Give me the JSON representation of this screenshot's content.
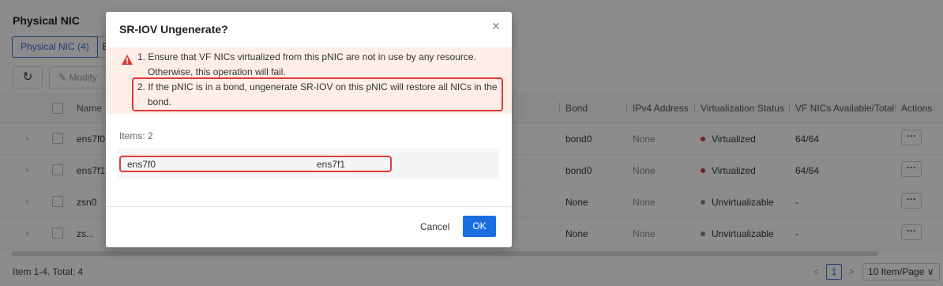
{
  "page": {
    "title": "Physical NIC",
    "tabs": [
      "Physical NIC (4)",
      "E"
    ],
    "toolbar": {
      "refresh_icon": "refresh-icon",
      "modify_label": "Modify"
    },
    "table": {
      "columns": {
        "name": "Name",
        "bond": "Bond",
        "ipv4": "IPv4 Address",
        "virt": "Virtualization Status",
        "vf": "VF NICs Available/Total",
        "actions": "Actions"
      },
      "rows": [
        {
          "name": "ens7f0",
          "bond": "bond0",
          "ipv4": "None",
          "status": "Virtualized",
          "status_color": "#d9363e",
          "vf": "64/64"
        },
        {
          "name": "ens7f1",
          "bond": "bond0",
          "ipv4": "None",
          "status": "Virtualized",
          "status_color": "#d9363e",
          "vf": "64/64"
        },
        {
          "name": "zsn0",
          "bond": "None",
          "ipv4": "None",
          "status": "Unvirtualizable",
          "status_color": "#888888",
          "vf": "-"
        },
        {
          "name": "zs...",
          "bond": "None",
          "ipv4": "None",
          "status": "Unvirtualizable",
          "status_color": "#888888",
          "vf": "-"
        }
      ],
      "actions_label": "···"
    },
    "footer": {
      "total": "Item 1-4. Total: 4",
      "current_page": "1",
      "page_size": "10 Item/Page"
    }
  },
  "dialog": {
    "title": "SR-IOV Ungenerate?",
    "close_icon": "close-icon",
    "warning_lines": [
      "1. Ensure that VF NICs virtualized from this pNIC are not in use by any resource.",
      "Otherwise, this operation will fail.",
      "2. If the pNIC is in a bond, ungenerate SR-IOV on this pNIC will restore all NICs in the",
      "bond."
    ],
    "items_label": "Items: 2",
    "items": [
      "ens7f0",
      "ens7f1"
    ],
    "cancel_label": "Cancel",
    "ok_label": "OK"
  },
  "colors": {
    "accent": "#1a6fe0",
    "warning_bg": "#fdeee8",
    "highlight_border": "#e03b3b",
    "warning_icon": "#e03b3b"
  }
}
